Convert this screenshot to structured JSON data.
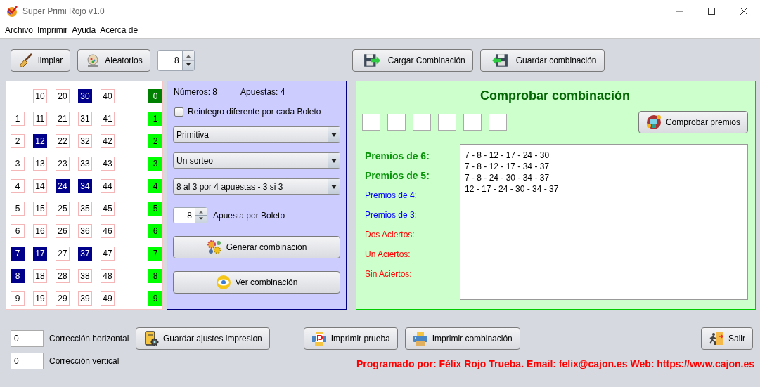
{
  "window": {
    "title": "Super Primi Rojo v1.0"
  },
  "menu": [
    "Archivo",
    "Imprimir",
    "Ayuda",
    "Acerca de"
  ],
  "toolbar": {
    "clear_button": "limpiar",
    "random_button": "Aleatorios",
    "count_spinner": "8",
    "load_button": "Cargar Combinación",
    "save_button": "Guardar combinación"
  },
  "number_grid": {
    "columns": [
      [
        {
          "label": "1",
          "selected": false
        },
        {
          "label": "2",
          "selected": false
        },
        {
          "label": "3",
          "selected": false
        },
        {
          "label": "4",
          "selected": false
        },
        {
          "label": "5",
          "selected": false
        },
        {
          "label": "6",
          "selected": false
        },
        {
          "label": "7",
          "selected": true
        },
        {
          "label": "8",
          "selected": true
        },
        {
          "label": "9",
          "selected": false
        }
      ],
      [
        {
          "label": "10",
          "selected": false
        },
        {
          "label": "11",
          "selected": false
        },
        {
          "label": "12",
          "selected": true
        },
        {
          "label": "13",
          "selected": false
        },
        {
          "label": "14",
          "selected": false
        },
        {
          "label": "15",
          "selected": false
        },
        {
          "label": "16",
          "selected": false
        },
        {
          "label": "17",
          "selected": true
        },
        {
          "label": "18",
          "selected": false
        },
        {
          "label": "19",
          "selected": false
        }
      ],
      [
        {
          "label": "20",
          "selected": false
        },
        {
          "label": "21",
          "selected": false
        },
        {
          "label": "22",
          "selected": false
        },
        {
          "label": "23",
          "selected": false
        },
        {
          "label": "24",
          "selected": true
        },
        {
          "label": "25",
          "selected": false
        },
        {
          "label": "26",
          "selected": false
        },
        {
          "label": "27",
          "selected": false
        },
        {
          "label": "28",
          "selected": false
        },
        {
          "label": "29",
          "selected": false
        }
      ],
      [
        {
          "label": "30",
          "selected": true
        },
        {
          "label": "31",
          "selected": false
        },
        {
          "label": "32",
          "selected": false
        },
        {
          "label": "33",
          "selected": false
        },
        {
          "label": "34",
          "selected": true
        },
        {
          "label": "35",
          "selected": false
        },
        {
          "label": "36",
          "selected": false
        },
        {
          "label": "37",
          "selected": true
        },
        {
          "label": "38",
          "selected": false
        },
        {
          "label": "39",
          "selected": false
        }
      ],
      [
        {
          "label": "40",
          "selected": false
        },
        {
          "label": "41",
          "selected": false
        },
        {
          "label": "42",
          "selected": false
        },
        {
          "label": "43",
          "selected": false
        },
        {
          "label": "44",
          "selected": false
        },
        {
          "label": "45",
          "selected": false
        },
        {
          "label": "46",
          "selected": false
        },
        {
          "label": "47",
          "selected": false
        },
        {
          "label": "48",
          "selected": false
        },
        {
          "label": "49",
          "selected": false
        }
      ]
    ],
    "reintegro": [
      {
        "label": "0",
        "selected": true
      },
      {
        "label": "1",
        "selected": false
      },
      {
        "label": "2",
        "selected": false
      },
      {
        "label": "3",
        "selected": false
      },
      {
        "label": "4",
        "selected": false
      },
      {
        "label": "5",
        "selected": false
      },
      {
        "label": "6",
        "selected": false
      },
      {
        "label": "7",
        "selected": false
      },
      {
        "label": "8",
        "selected": false
      },
      {
        "label": "9",
        "selected": false
      }
    ]
  },
  "options_panel": {
    "numbers": "Números: 8",
    "bets": "Apuestas: 4",
    "reintegro_checkbox": {
      "label": "Reintegro diferente por cada Boleto",
      "checked": false
    },
    "dropdowns": [
      "Primitiva",
      "Un sorteo",
      "8 al 3 por 4 apuestas - 3 si 3"
    ],
    "bets_spinner": {
      "value": "8",
      "label": "Apuesta por Boleto"
    },
    "generate_button": "Generar combinación",
    "view_button": "Ver combinación"
  },
  "check_panel": {
    "title": "Comprobar combinación",
    "number_fields": [
      {
        "kind": "empty"
      },
      {
        "kind": "empty"
      },
      {
        "kind": "empty"
      },
      {
        "kind": "empty"
      },
      {
        "kind": "empty"
      },
      {
        "kind": "empty"
      }
    ],
    "check_button": "Comprobar premios",
    "prize_labels": [
      {
        "label": "Premios de 6:",
        "kind": "major",
        "color": "#0a960a"
      },
      {
        "label": "Premios de 5:",
        "kind": "major",
        "color": "#0a960a"
      },
      {
        "label": "Premios de 4:",
        "kind": "minor",
        "color": "#0000ff"
      },
      {
        "label": "Premios de 3:",
        "kind": "minor",
        "color": "#0000ff"
      },
      {
        "label": "Dos Aciertos:",
        "kind": "minor",
        "color": "#ff0000"
      },
      {
        "label": "Un Aciertos:",
        "kind": "minor",
        "color": "#ff0000"
      },
      {
        "label": "Sin Aciertos:",
        "kind": "minor",
        "color": "#ff0000"
      }
    ],
    "results": [
      "7 - 8 - 12 - 17 - 24 - 30",
      "7 - 8 - 12 - 17 - 34 - 37",
      "7 - 8 - 24 - 30 - 34 - 37",
      "12 - 17 - 24 - 30 - 34 - 37"
    ]
  },
  "print_settings": {
    "corrections": [
      {
        "value": "0",
        "label": "Corrección horizontal"
      },
      {
        "value": "0",
        "label": "Corrección vertical"
      }
    ],
    "save_button": "Guardar ajustes impresion"
  },
  "print_buttons": [
    "Imprimir prueba",
    "Imprimir combinación"
  ],
  "exit_button": "Salir",
  "footer": "Programado por: Félix Rojo Trueba. Email: felix@cajon.es Web: https://www.cajon.es"
}
